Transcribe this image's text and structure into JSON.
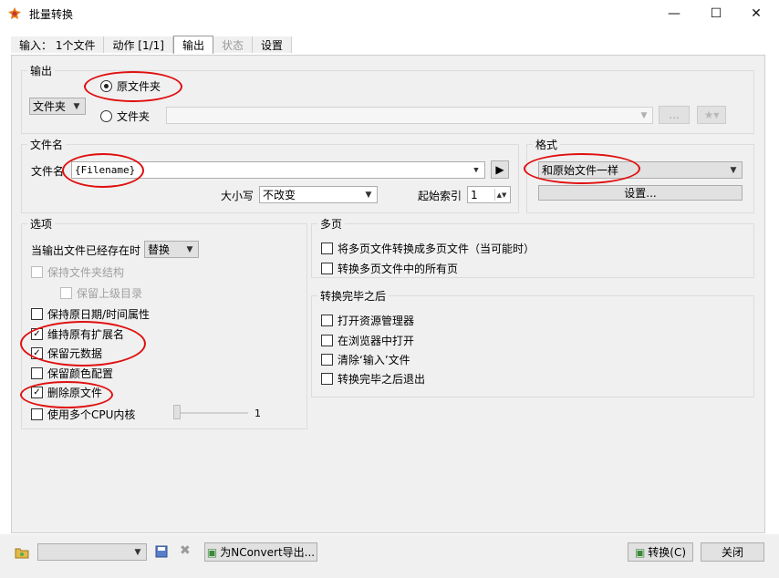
{
  "window": {
    "title": "批量转换",
    "minimize": "—",
    "maximize": "☐",
    "close": "✕"
  },
  "tabs": [
    {
      "label": "输入： 1个文件"
    },
    {
      "label": "动作 [1/1]"
    },
    {
      "label": "输出"
    },
    {
      "label": "状态"
    },
    {
      "label": "设置"
    }
  ],
  "output": {
    "group": "输出",
    "folder_type": "文件夹",
    "radio_original": "原文件夹",
    "radio_folder": "文件夹",
    "folder_path": "",
    "browse": "...",
    "fav_icon": "star-icon"
  },
  "filename": {
    "group": "文件名",
    "label": "文件名",
    "value": "{Filename}",
    "case_label": "大小写",
    "case_value": "不改变",
    "start_label": "起始索引",
    "start_value": "1"
  },
  "format": {
    "group": "格式",
    "value": "和原始文件一样",
    "settings": "设置..."
  },
  "options": {
    "group": "选项",
    "exists_label": "当输出文件已经存在时",
    "exists_value": "替换",
    "keep_structure": "保持文件夹结构",
    "keep_parent": "保留上级目录",
    "keep_date": "保持原日期/时间属性",
    "keep_ext": "维持原有扩展名",
    "keep_meta": "保留元数据",
    "keep_color": "保留颜色配置",
    "delete_original": "删除原文件",
    "multi_cpu": "使用多个CPU内核",
    "cpu_value": "1"
  },
  "multipage": {
    "group": "多页",
    "to_multi": "将多页文件转换成多页文件（当可能时）",
    "all_pages": "转换多页文件中的所有页"
  },
  "after": {
    "group": "转换完毕之后",
    "open_explorer": "打开资源管理器",
    "open_browser": "在浏览器中打开",
    "clear_input": "清除‘输入’文件",
    "exit_after": "转换完毕之后退出"
  },
  "footer": {
    "preset": "",
    "export": "为NConvert导出...",
    "convert": "转换(C)",
    "close": "关闭"
  }
}
